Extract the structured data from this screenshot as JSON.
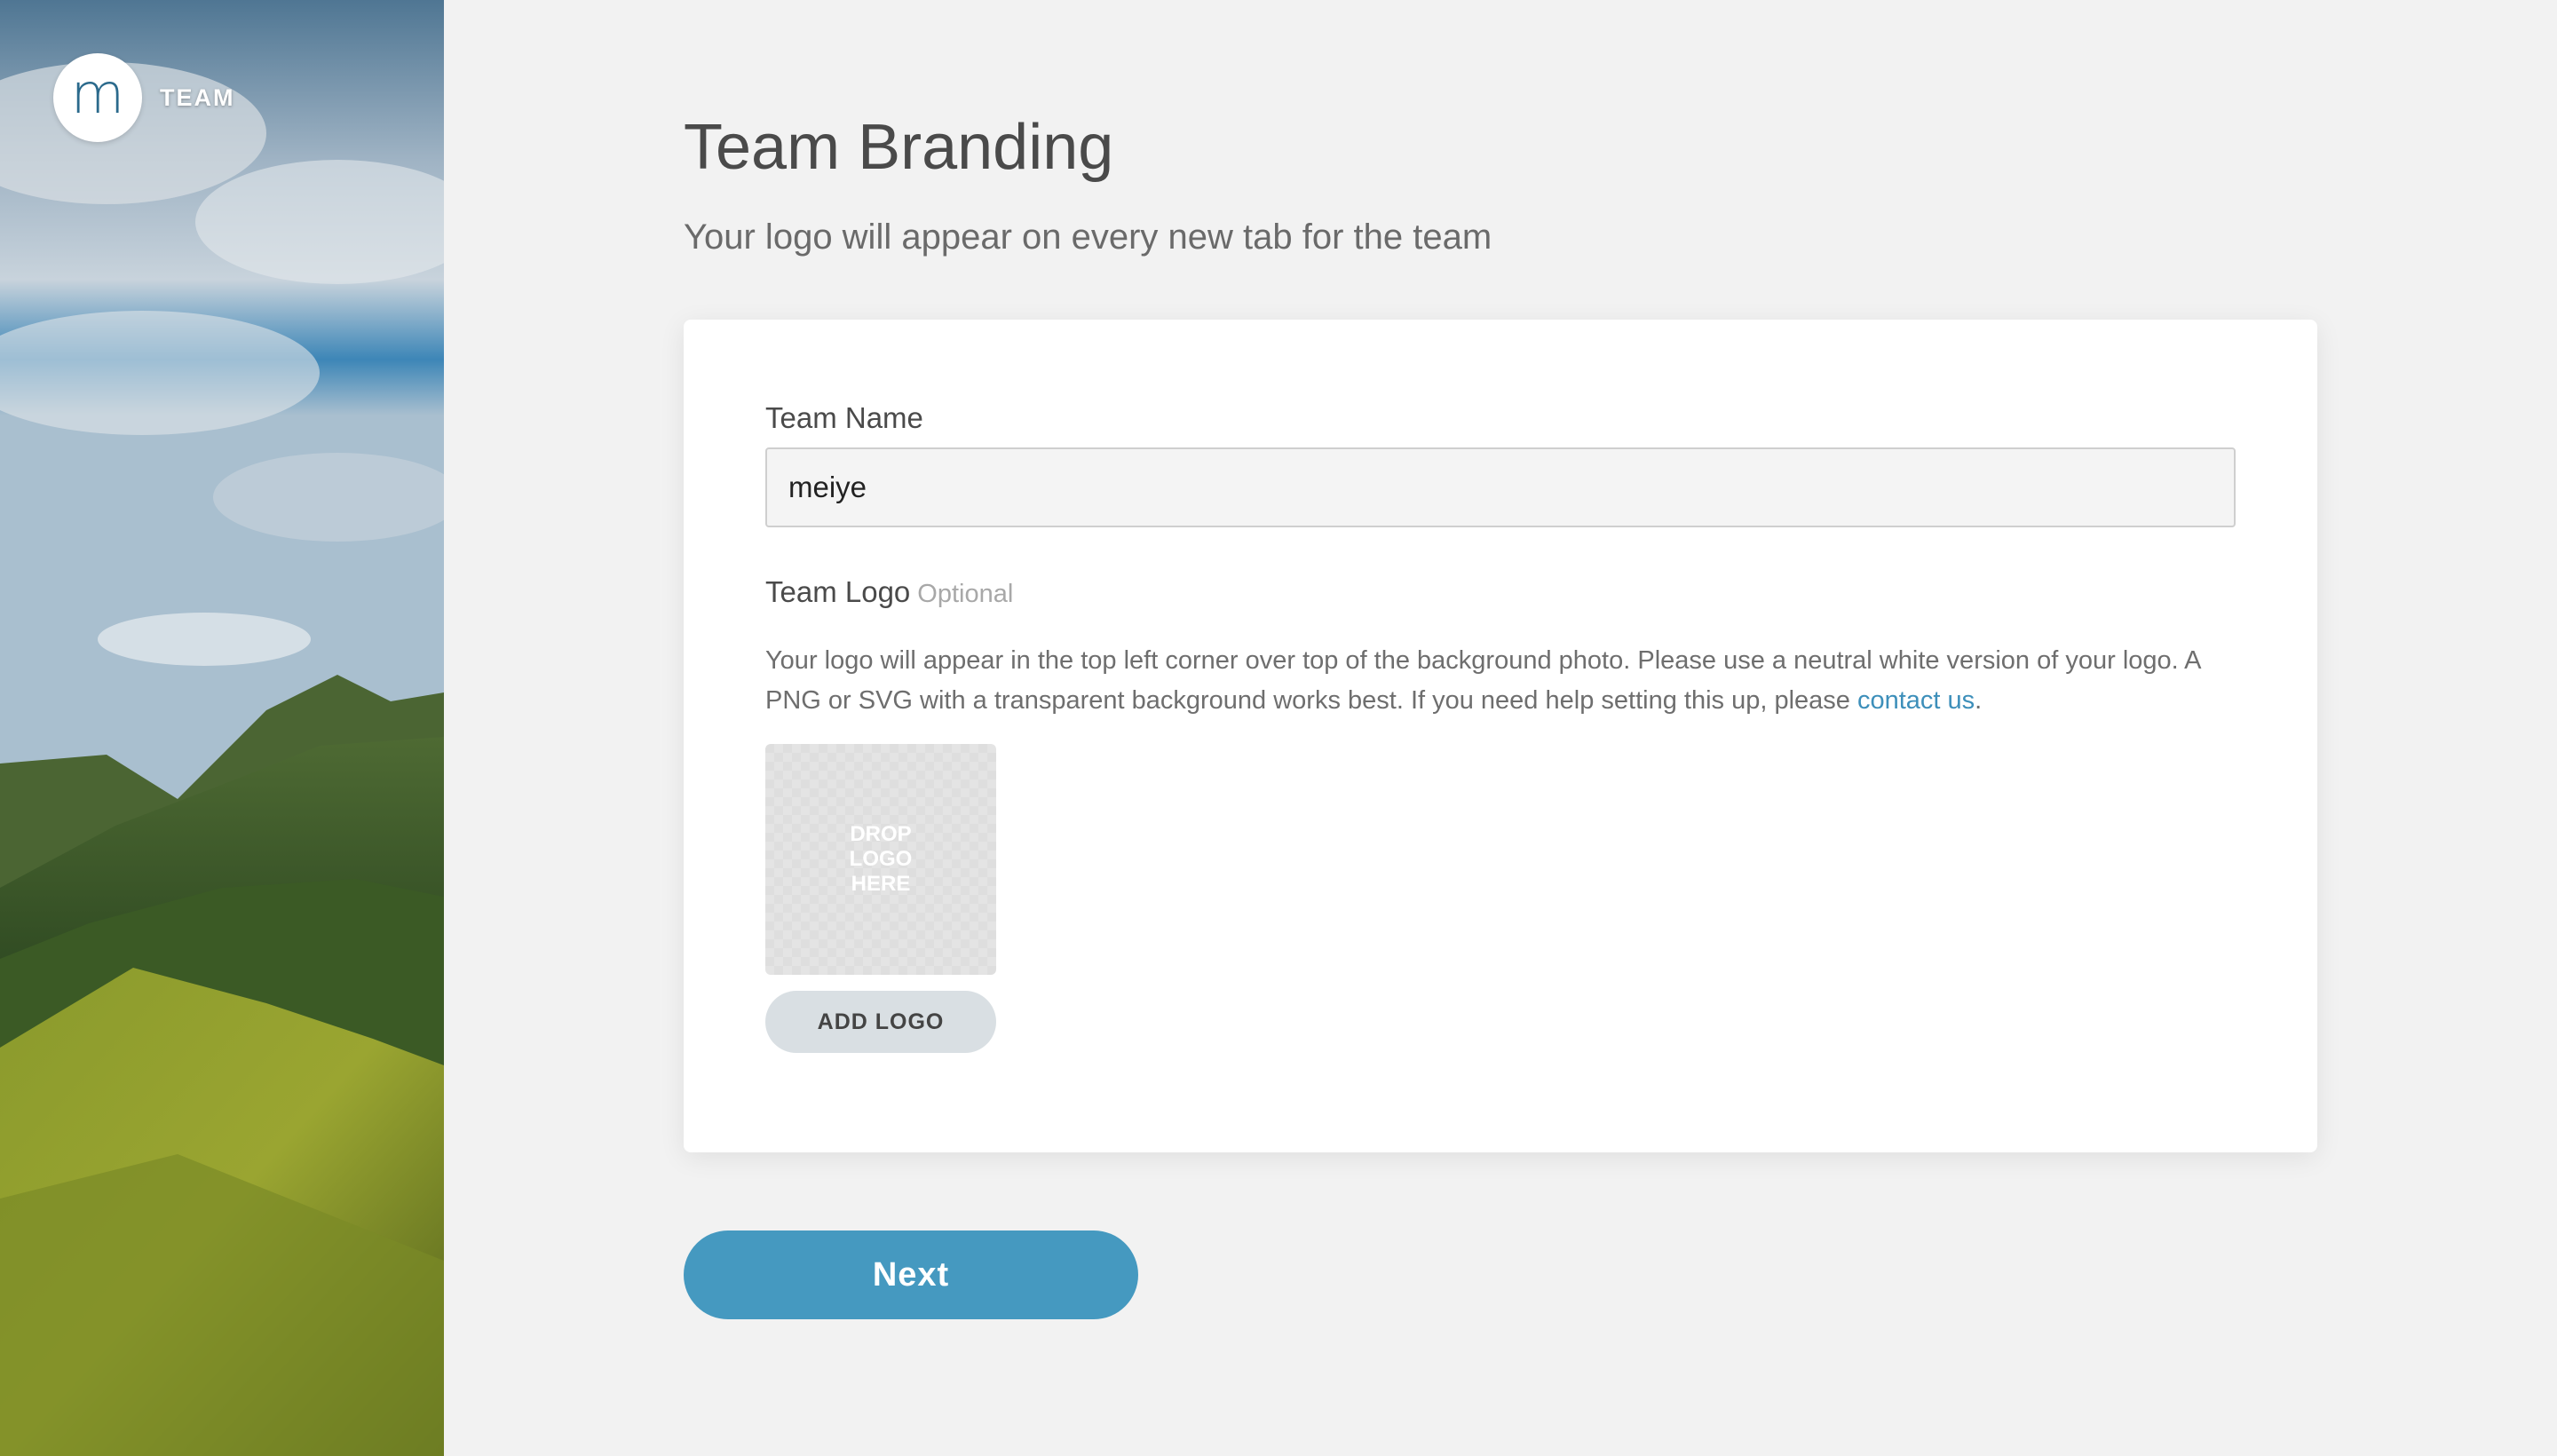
{
  "brand": {
    "logo_letter": "m",
    "label": "TEAM"
  },
  "page": {
    "title": "Team Branding",
    "subtitle": "Your logo will appear on every new tab for the team"
  },
  "form": {
    "team_name_label": "Team Name",
    "team_name_value": "meiye",
    "team_logo_label": "Team Logo",
    "team_logo_optional": "Optional",
    "help_text": "Your logo will appear in the top left corner over top of the background photo. Please use a neutral white version of your logo. A PNG or SVG with a transparent background works best. If you need help setting this up, please ",
    "help_link": "contact us",
    "help_end": ".",
    "dropzone_text": "DROP LOGO HERE",
    "add_logo_label": "ADD LOGO"
  },
  "actions": {
    "next_label": "Next"
  },
  "colors": {
    "accent": "#4599c0",
    "link": "#3d8fba",
    "background": "#f2f2f2"
  }
}
